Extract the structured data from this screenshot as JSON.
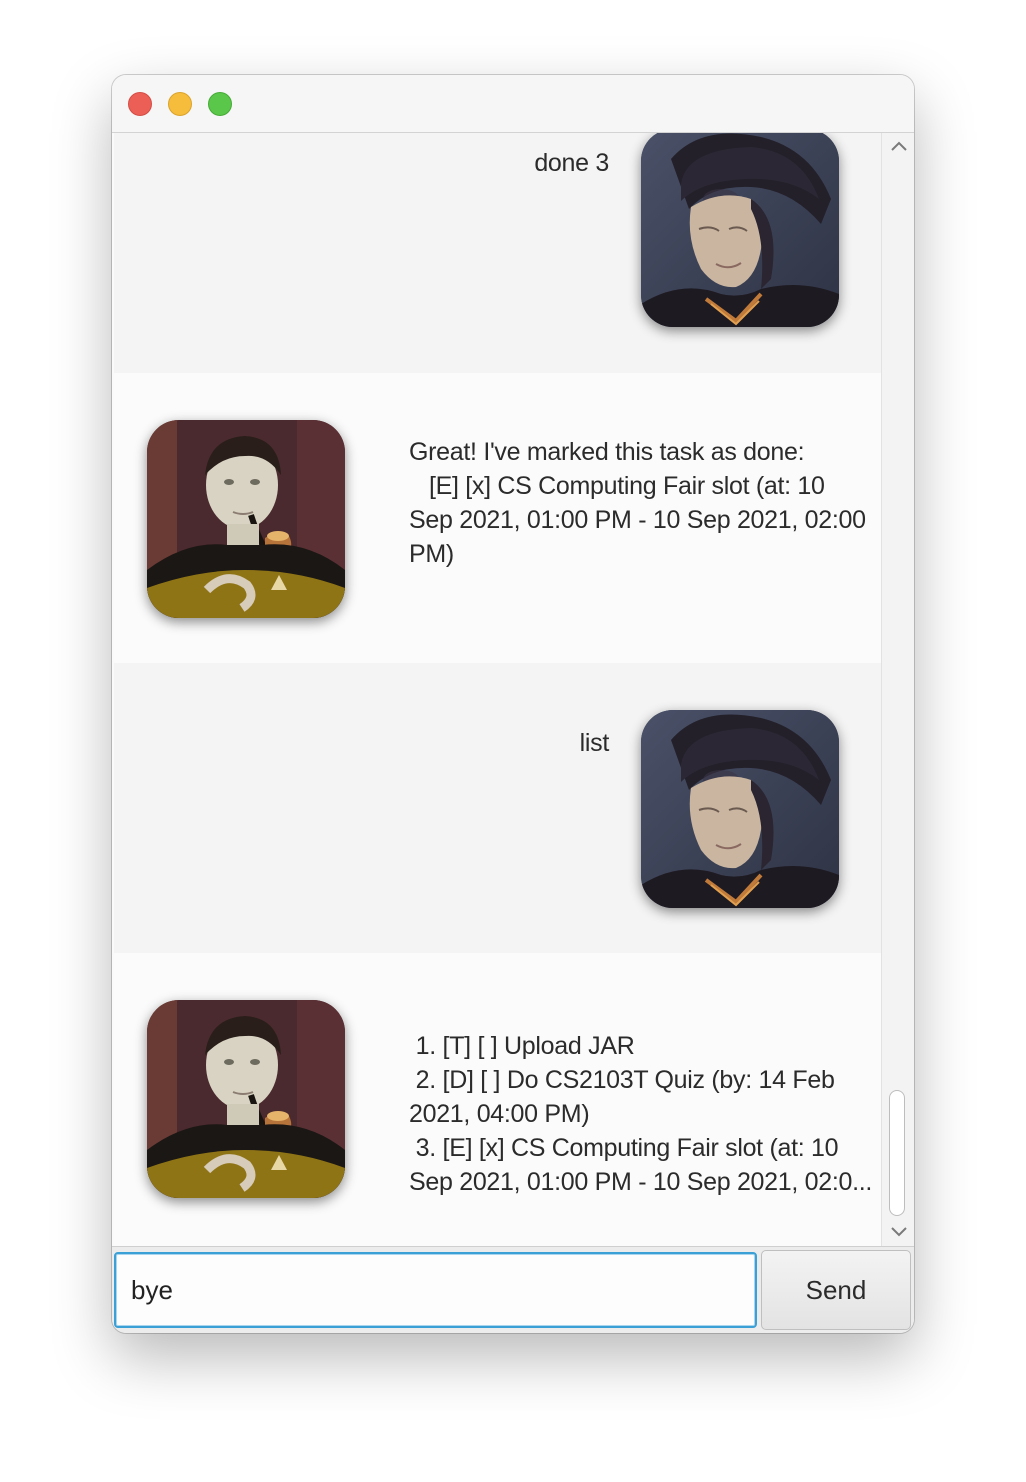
{
  "window": {
    "controls": [
      "close",
      "minimize",
      "maximize"
    ]
  },
  "dialogs": [
    {
      "speaker": "user",
      "text": "done 3",
      "avatar": "portrait-painting-avatar"
    },
    {
      "speaker": "bot",
      "text": "Great! I've marked this task as done:\n   [E] [x] CS Computing Fair slot (at: 10\nSep 2021, 01:00 PM - 10 Sep 2021, 02:00\nPM)",
      "avatar": "android-with-pipe-avatar"
    },
    {
      "speaker": "user",
      "text": "list",
      "avatar": "portrait-painting-avatar"
    },
    {
      "speaker": "bot",
      "text": " 1. [T] [ ] Upload JAR\n 2. [D] [ ] Do CS2103T Quiz (by: 14 Feb\n2021, 04:00 PM)\n 3. [E] [x] CS Computing Fair slot (at: 10\nSep 2021, 01:00 PM - 10 Sep 2021, 02:0...",
      "avatar": "android-with-pipe-avatar"
    }
  ],
  "input": {
    "value": "bye"
  },
  "send_button": {
    "label": "Send"
  },
  "colors": {
    "input_focus": "#3aa0d5",
    "close": "#ec5f57",
    "minimize": "#f5bd3b",
    "maximize": "#5ac64a"
  },
  "icons": [
    "scroll-up-arrow-icon",
    "scroll-down-arrow-icon"
  ]
}
